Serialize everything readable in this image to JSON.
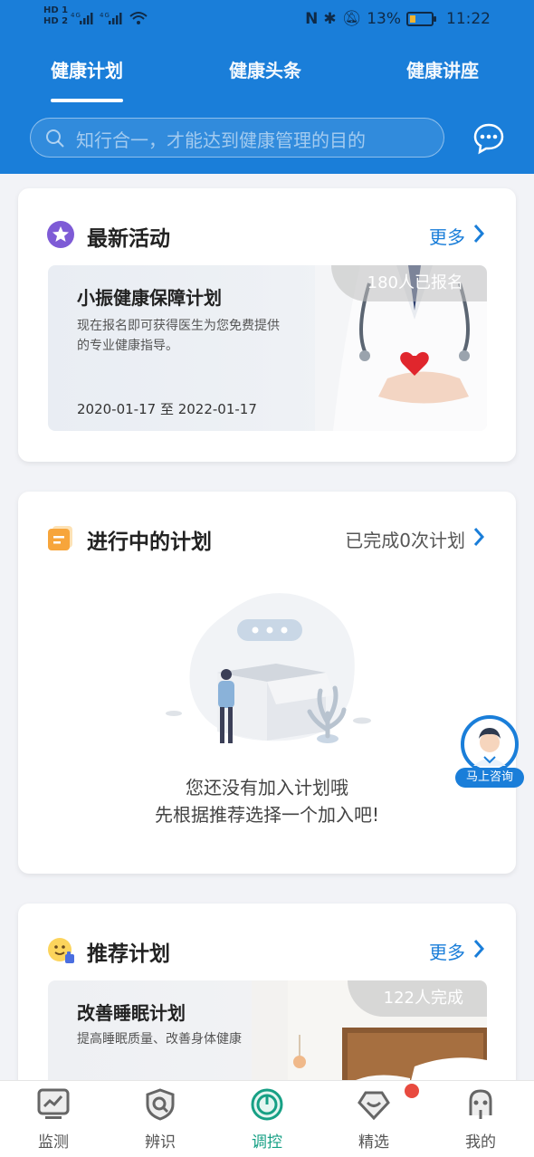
{
  "status_bar": {
    "hd1": "HD 1",
    "hd2": "HD 2",
    "signal": "4G❘ 4G❘",
    "battery_pct": "13%",
    "time": "11:22"
  },
  "tabs": [
    {
      "label": "健康计划",
      "active": true
    },
    {
      "label": "健康头条",
      "active": false
    },
    {
      "label": "健康讲座",
      "active": false
    }
  ],
  "search": {
    "placeholder": "知行合一，才能达到健康管理的目的"
  },
  "latest": {
    "title": "最新活动",
    "more": "更多",
    "banner": {
      "title": "小振健康保障计划",
      "desc": "现在报名即可获得医生为您免费提供的专业健康指导。",
      "date": "2020-01-17 至 2022-01-17",
      "tag": "180人已报名"
    }
  },
  "ongoing": {
    "title": "进行中的计划",
    "completed": "已完成0次计划",
    "empty_line1": "您还没有加入计划哦",
    "empty_line2": "先根据推荐选择一个加入吧!"
  },
  "consult": {
    "label": "马上咨询"
  },
  "recommend": {
    "title": "推荐计划",
    "more": "更多",
    "banner": {
      "title": "改善睡眠计划",
      "desc": "提高睡眠质量、改善身体健康",
      "tag": "122人完成"
    }
  },
  "nav": [
    {
      "label": "监测",
      "icon": "monitor-icon"
    },
    {
      "label": "辨识",
      "icon": "shield-search-icon"
    },
    {
      "label": "调控",
      "icon": "power-icon",
      "active": true
    },
    {
      "label": "精选",
      "icon": "heart-diamond-icon"
    },
    {
      "label": "我的",
      "icon": "person-icon"
    }
  ],
  "colors": {
    "primary": "#1a7ed9",
    "active_nav": "#17a085",
    "badge": "#e84a3f"
  }
}
